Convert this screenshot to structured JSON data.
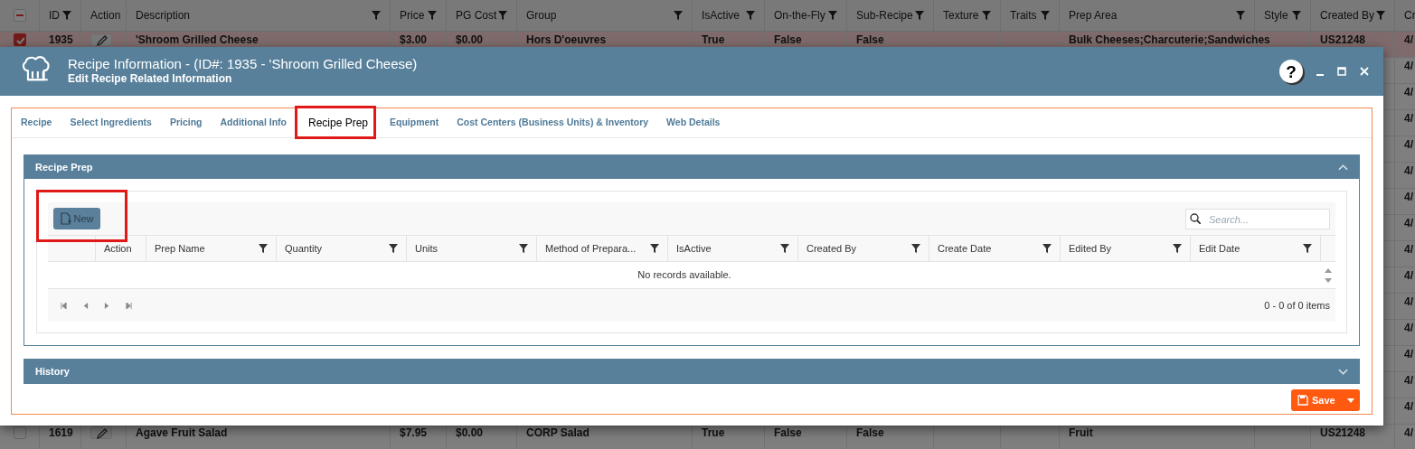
{
  "table": {
    "select_all_partial": true,
    "columns": [
      {
        "label": "ID",
        "filterable": true
      },
      {
        "label": "Action",
        "filterable": false
      },
      {
        "label": "Description",
        "filterable": true
      },
      {
        "label": "Price",
        "filterable": true
      },
      {
        "label": "PG Cost",
        "filterable": true
      },
      {
        "label": "Group",
        "filterable": true
      },
      {
        "label": "IsActive",
        "filterable": true
      },
      {
        "label": "On-the-Fly",
        "filterable": true
      },
      {
        "label": "Sub-Recipe",
        "filterable": true
      },
      {
        "label": "Texture",
        "filterable": true
      },
      {
        "label": "Traits",
        "filterable": true
      },
      {
        "label": "Prep Area",
        "filterable": true
      },
      {
        "label": "Style",
        "filterable": true
      },
      {
        "label": "Created By",
        "filterable": true
      },
      {
        "label": "Cr",
        "filterable": false
      }
    ],
    "rows": [
      {
        "selected": true,
        "id": "1935",
        "description": "'Shroom Grilled Cheese",
        "price": "$3.00",
        "pg_cost": "$0.00",
        "group": "Hors D'oeuvres",
        "is_active": "True",
        "on_the_fly": "False",
        "sub_recipe": "False",
        "prep_area": "Bulk Cheeses;Charcuterie;Sandwiches",
        "created_by": "US21248",
        "column_16": "4/"
      },
      {
        "selected": false,
        "column_16": "4/"
      },
      {
        "selected": false,
        "column_16": "4/"
      },
      {
        "selected": false,
        "column_16": "4/"
      },
      {
        "selected": false,
        "column_16": "4/"
      },
      {
        "selected": false,
        "column_16": "4/"
      },
      {
        "selected": false,
        "column_16": "4/"
      },
      {
        "selected": false,
        "column_16": "4/"
      },
      {
        "selected": false,
        "column_16": "4/"
      },
      {
        "selected": false,
        "column_16": "4/"
      },
      {
        "selected": false,
        "column_16": "4/"
      },
      {
        "selected": false,
        "column_16": "4/"
      },
      {
        "selected": false,
        "column_16": "4/"
      },
      {
        "selected": false,
        "column_16": "4/"
      },
      {
        "selected": false,
        "column_16": "4/"
      },
      {
        "selected": false,
        "id": "1619",
        "description": "Agave Fruit Salad",
        "price": "$7.95",
        "pg_cost": "$0.00",
        "group": "CORP Salad",
        "is_active": "True",
        "on_the_fly": "False",
        "sub_recipe": "False",
        "prep_area": "Fruit",
        "created_by": "US21248",
        "column_16": "4/"
      }
    ]
  },
  "dialog": {
    "title": "Recipe Information - (ID#: 1935 - 'Shroom Grilled Cheese)",
    "subtitle": "Edit Recipe Related Information",
    "help_button": "?",
    "tabs": [
      {
        "label": "Recipe",
        "selected": false
      },
      {
        "label": "Select Ingredients",
        "selected": false
      },
      {
        "label": "Pricing",
        "selected": false
      },
      {
        "label": "Additional Info",
        "selected": false
      },
      {
        "label": "Recipe Prep",
        "selected": true
      },
      {
        "label": "Equipment",
        "selected": false
      },
      {
        "label": "Cost Centers (Business Units) & Inventory",
        "selected": false
      },
      {
        "label": "Web Details",
        "selected": false
      }
    ],
    "panels": [
      {
        "title": "Recipe Prep",
        "expanded": true,
        "new_button": "New",
        "search": {
          "placeholder": "Search..."
        },
        "columns": [
          {
            "label": "Action",
            "filterable": false
          },
          {
            "label": "Prep Name",
            "filterable": true
          },
          {
            "label": "Quantity",
            "filterable": true
          },
          {
            "label": "Units",
            "filterable": true
          },
          {
            "label": "Method of Prepara...",
            "filterable": true
          },
          {
            "label": "IsActive",
            "filterable": true
          },
          {
            "label": "Created By",
            "filterable": true
          },
          {
            "label": "Create Date",
            "filterable": true
          },
          {
            "label": "Edited By",
            "filterable": true
          },
          {
            "label": "Edit Date",
            "filterable": true
          }
        ],
        "empty_message": "No records available.",
        "pager_info": "0 - 0 of 0 items"
      },
      {
        "title": "History",
        "expanded": false
      }
    ],
    "save_button": "Save"
  }
}
